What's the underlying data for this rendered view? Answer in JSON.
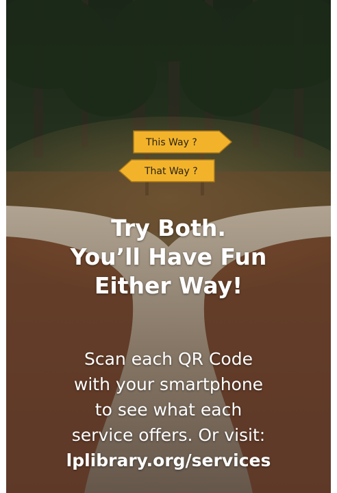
{
  "signs": {
    "top": "This Way ?",
    "bottom": "That Way ?"
  },
  "headline": {
    "line1": "Try Both.",
    "line2": "You’ll Have Fun",
    "line3": "Either Way!"
  },
  "body": {
    "line1": "Scan each QR Code",
    "line2": "with your smartphone",
    "line3": "to see what each",
    "line4": "service offers. Or visit:",
    "url": "lplibrary.org/services"
  },
  "colors": {
    "sign": "#f2b32b",
    "text": "#ffffff",
    "forest": "#1f2a1c",
    "path": "#8a7a6a"
  }
}
